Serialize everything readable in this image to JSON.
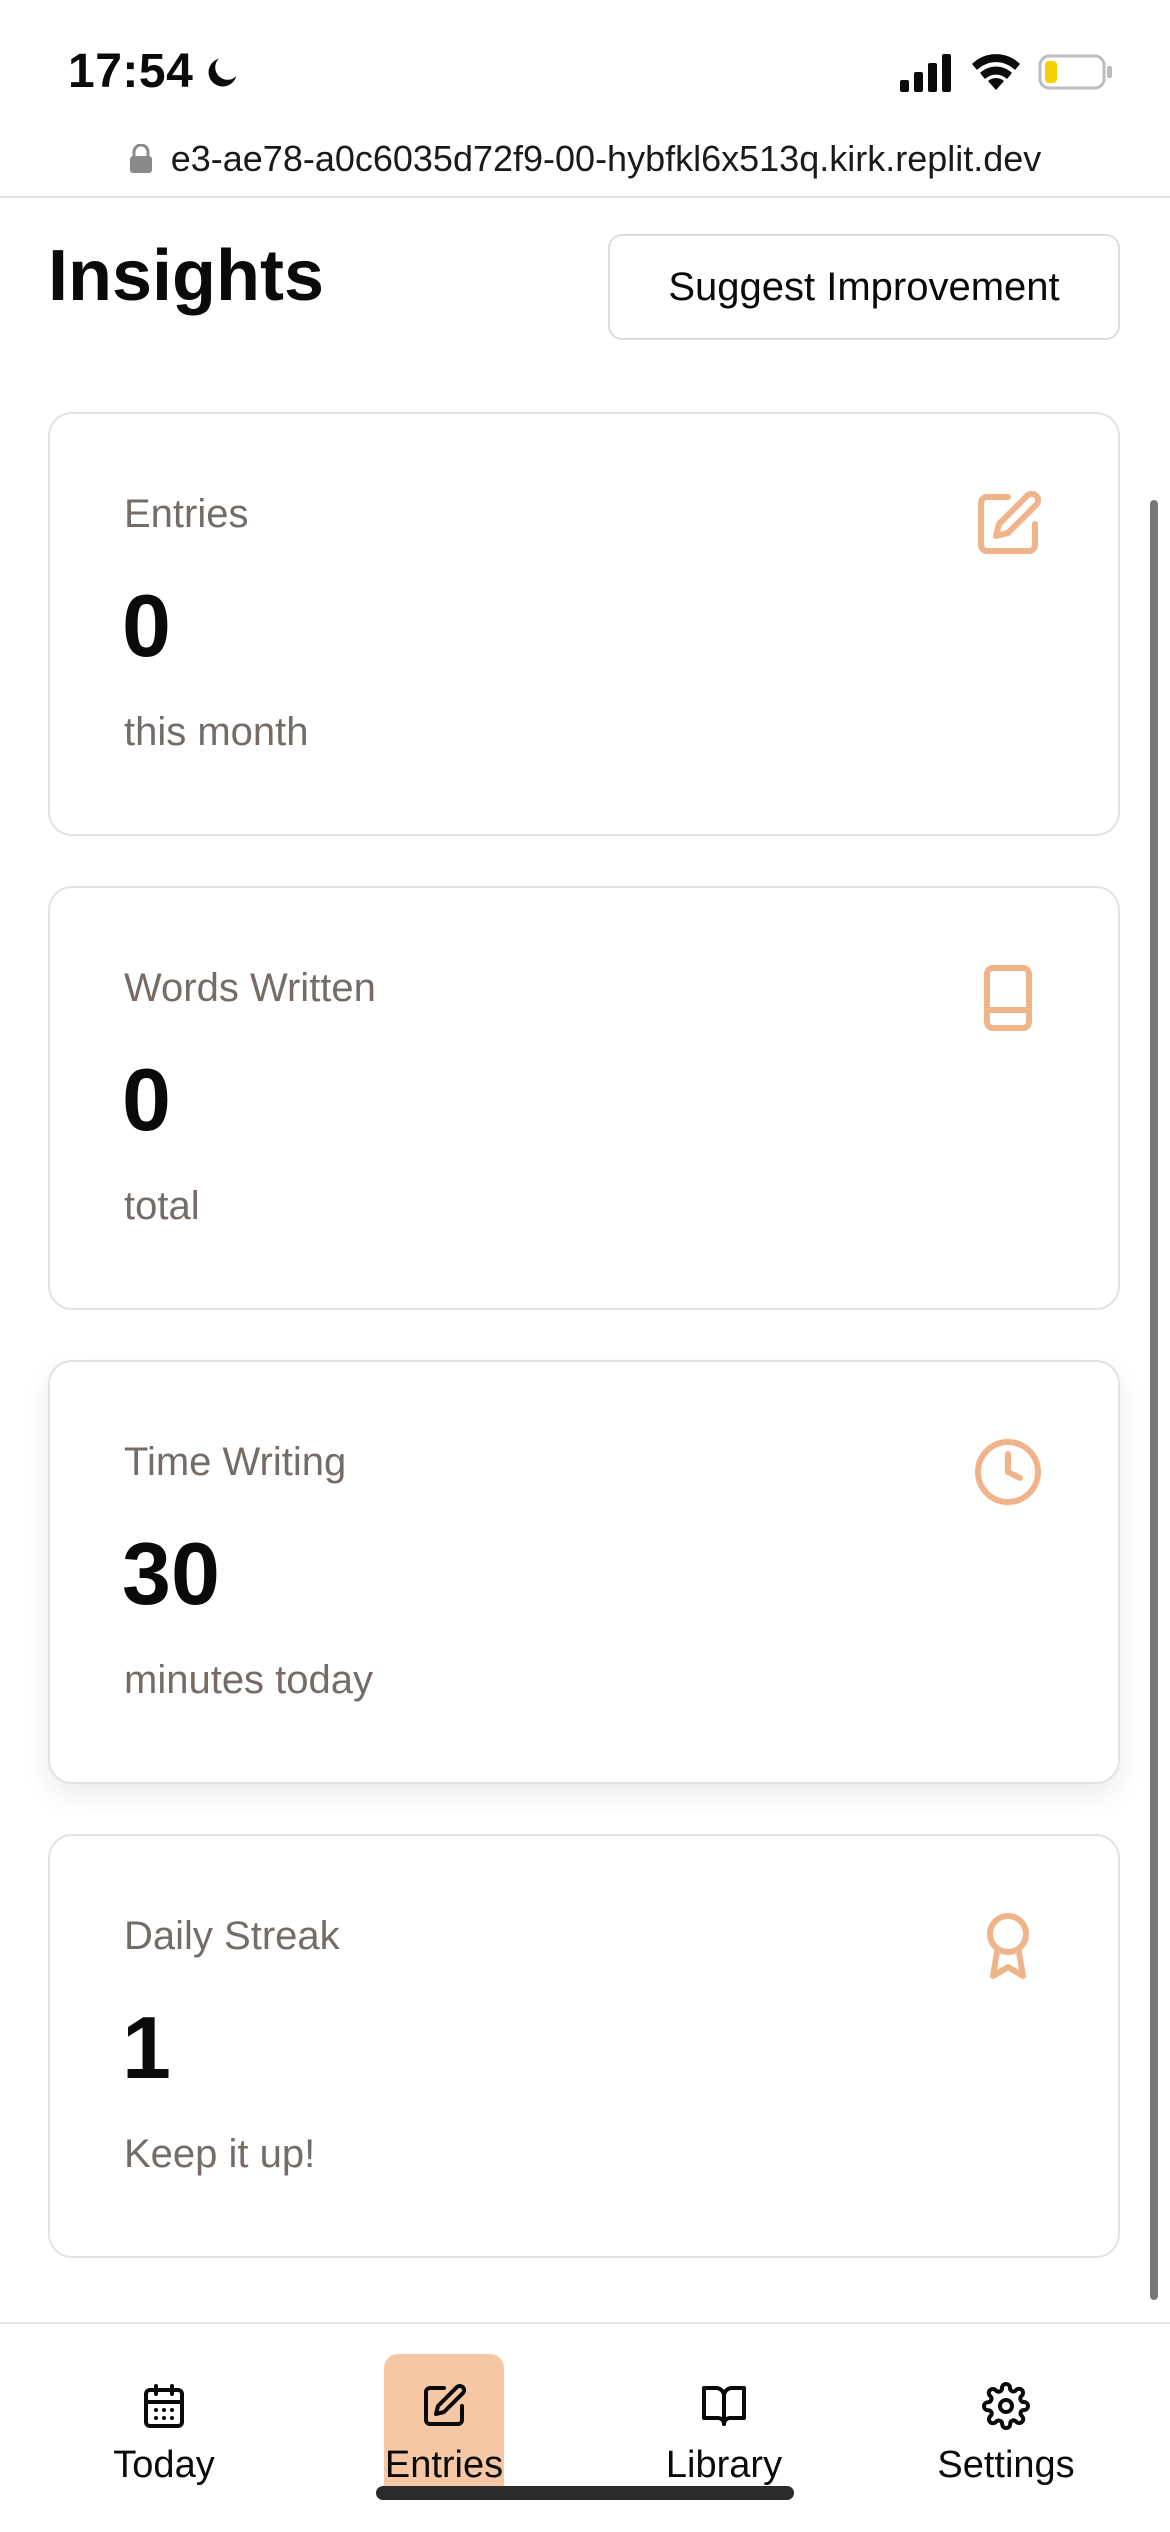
{
  "status_bar": {
    "time": "17:54"
  },
  "browser": {
    "url": "e3-ae78-a0c6035d72f9-00-hybfkl6x513q.kirk.replit.dev"
  },
  "header": {
    "title": "Insights",
    "suggest_label": "Suggest Improvement"
  },
  "accent_color": "#f6c7a5",
  "icon_color": "#f0b48b",
  "cards": [
    {
      "label": "Entries",
      "value": "0",
      "sub": "this month",
      "icon": "edit-icon"
    },
    {
      "label": "Words Written",
      "value": "0",
      "sub": "total",
      "icon": "book-icon"
    },
    {
      "label": "Time Writing",
      "value": "30",
      "sub": "minutes today",
      "icon": "clock-icon"
    },
    {
      "label": "Daily Streak",
      "value": "1",
      "sub": "Keep it up!",
      "icon": "award-icon"
    }
  ],
  "nav": {
    "active": "Entries",
    "items": [
      {
        "label": "Today",
        "icon": "calendar-icon"
      },
      {
        "label": "Entries",
        "icon": "edit-icon"
      },
      {
        "label": "Library",
        "icon": "open-book-icon"
      },
      {
        "label": "Settings",
        "icon": "gear-icon"
      }
    ]
  }
}
